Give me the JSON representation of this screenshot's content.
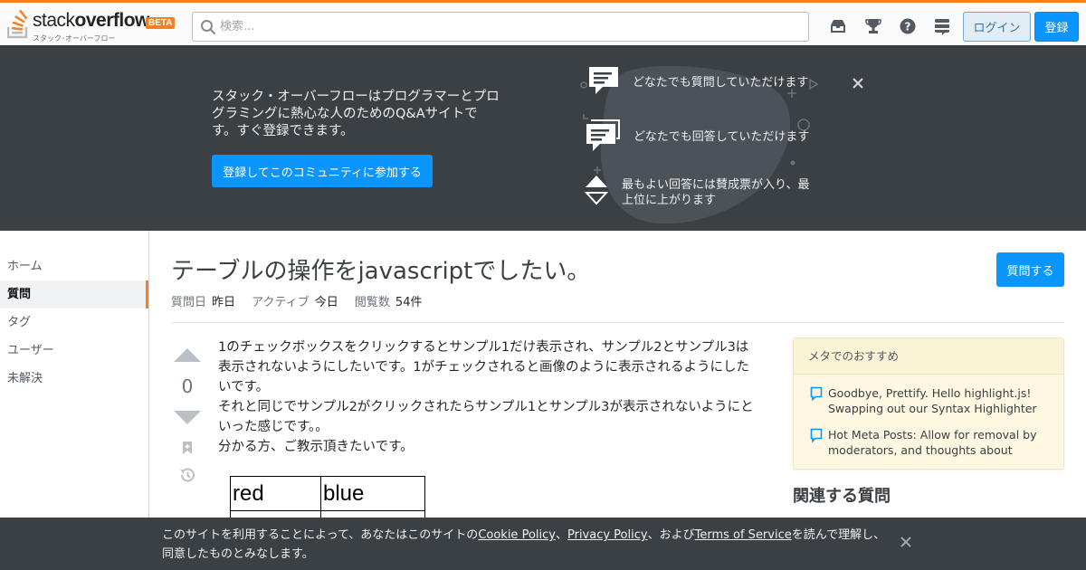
{
  "header": {
    "logo_word_light": "stack",
    "logo_word_bold": "overflow",
    "logo_beta": "BETA",
    "logo_sub": "スタック･オーバーフロー",
    "search_placeholder": "検索...",
    "login_label": "ログイン",
    "signup_label": "登録",
    "icons": [
      "inbox-icon",
      "achievements-icon",
      "help-icon",
      "site-switcher-icon"
    ],
    "accent_color": "#f48024"
  },
  "hero": {
    "description": "スタック・オーバーフローはプログラマーとプログラミングに熱心な人のためのQ&Aサイトです。すぐ登録できます。",
    "cta_label": "登録してこのコミュニティに参加する",
    "features": [
      {
        "icon": "ask-question-icon",
        "text": "どなたでも質問していただけます"
      },
      {
        "icon": "answer-icon",
        "text": "どなたでも回答していただけます"
      },
      {
        "icon": "vote-arrows-icon",
        "text": "最もよい回答には賛成票が入り、最上位に上がります"
      }
    ]
  },
  "nav": {
    "items": [
      {
        "label": "ホーム",
        "active": false
      },
      {
        "label": "質問",
        "active": true
      },
      {
        "label": "タグ",
        "active": false
      },
      {
        "label": "ユーザー",
        "active": false
      },
      {
        "label": "未解決",
        "active": false
      }
    ]
  },
  "question": {
    "title": "テーブルの操作をjavascriptでしたい。",
    "ask_label": "質問する",
    "meta": [
      {
        "key": "質問日",
        "value": "昨日"
      },
      {
        "key": "アクティブ",
        "value": "今日"
      },
      {
        "key": "閲覧数",
        "value": "54件"
      }
    ],
    "vote_count": "0",
    "body": [
      "1のチェックボックスをクリックするとサンプル1だけ表示され、サンプル2とサンプル3は表示されないようにしたいです。1がチェックされると画像のように表示されるようにしたいです。",
      "それと同じでサンプル2がクリックされたらサンプル1とサンプル3が表示されないようにといった感じです。。",
      "分かる方、ご教示頂きたいです。"
    ],
    "table_headers": [
      "red",
      "blue"
    ]
  },
  "sidebar": {
    "meta_title": "メタでのおすすめ",
    "meta_items": [
      "Goodbye, Prettify. Hello highlight.js! Swapping out our Syntax Highlighter",
      "Hot Meta Posts: Allow for removal by moderators, and thoughts about future…"
    ],
    "related_title": "関連する質問"
  },
  "cookie": {
    "prefix": "このサイトを利用することによって、あなたはこのサイトの",
    "cookie_policy": "Cookie Policy",
    "sep1": "、",
    "privacy_policy": "Privacy Policy",
    "sep2": "、および",
    "terms": "Terms of Service",
    "suffix": "を読んで理解し、同意したものとみなします。"
  }
}
